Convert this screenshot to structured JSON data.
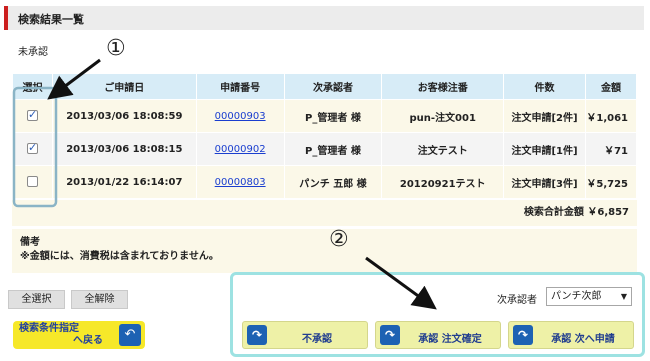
{
  "page": {
    "title": "検索結果一覧",
    "status": "未承認"
  },
  "table": {
    "headers": [
      "選択",
      "ご申請日",
      "申請番号",
      "次承認者",
      "お客様注番",
      "件数",
      "金額"
    ],
    "rows": [
      {
        "checked": true,
        "date": "2013/03/06 18:08:59",
        "number": "00000903",
        "approver": "P_管理者 様",
        "order": "pun-注文001",
        "count": "注文申請[2件]",
        "amount": "￥1,061"
      },
      {
        "checked": true,
        "date": "2013/03/06 18:08:15",
        "number": "00000902",
        "approver": "P_管理者 様",
        "order": "注文テスト",
        "count": "注文申請[1件]",
        "amount": "￥71"
      },
      {
        "checked": false,
        "date": "2013/01/22 16:14:07",
        "number": "00000803",
        "approver": "パンチ 五郎 様",
        "order": "20120921テスト",
        "count": "注文申請[3件]",
        "amount": "￥5,725"
      }
    ]
  },
  "total": "検索合計金額 ￥6,857",
  "note": {
    "heading": "備考",
    "text": "※金額には、消費税は含まれておりません。"
  },
  "buttons": {
    "select_all": "全選択",
    "clear_all": "全解除",
    "back_line1": "検索条件指定",
    "back_line2": "へ戻る"
  },
  "actions": {
    "approver_label": "次承認者",
    "approver_value": "パンチ次郎",
    "reject": "不承認",
    "approve_confirm": "承認 注文確定",
    "approve_next": "承認 次へ申請"
  },
  "annotations": {
    "one": "①",
    "two": "②"
  },
  "colors": {
    "accent_red": "#cc1f1f",
    "header_blue": "#d7ecf7",
    "row_cream": "#fbf8e8",
    "highlight_cyan": "#9de2e2",
    "button_yellow": "#f6e829",
    "icon_blue": "#1d62b3"
  }
}
